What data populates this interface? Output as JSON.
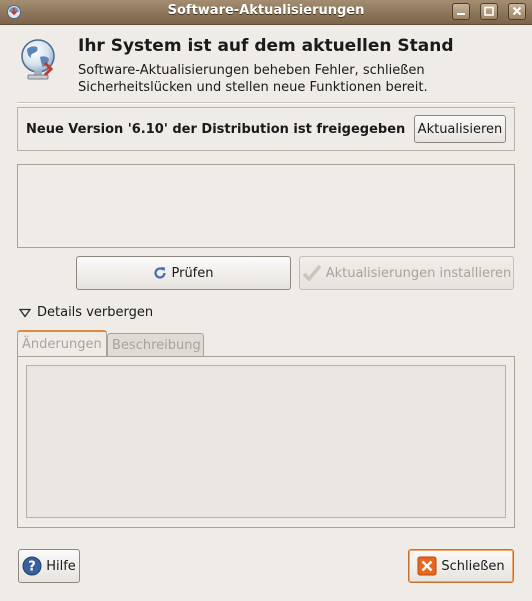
{
  "window": {
    "title": "Software-Aktualisierungen"
  },
  "header": {
    "title": "Ihr System ist auf dem aktuellen Stand",
    "description_line1": "Software-Aktualisierungen beheben Fehler, schließen",
    "description_line2": "Sicherheitslücken und stellen neue Funktionen bereit."
  },
  "release": {
    "message": "Neue Version '6.10' der Distribution ist freigegeben",
    "upgrade_button": "Aktualisieren"
  },
  "actions": {
    "check_button": "Prüfen",
    "install_button": "Aktualisierungen installieren"
  },
  "details": {
    "toggle_label": "Details verbergen",
    "tabs": [
      {
        "label": "Änderungen",
        "active": true
      },
      {
        "label": "Beschreibung",
        "active": false
      }
    ]
  },
  "footer": {
    "help_button": "Hilfe",
    "close_button": "Schließen"
  },
  "icons": {
    "title_icon": "update-manager-icon",
    "header_icon": "globe-update-icon",
    "check_icon": "refresh-icon",
    "install_icon": "checkmark-icon",
    "help_icon": "help-icon",
    "close_icon": "close-icon"
  },
  "colors": {
    "titlebar": "#8c7558",
    "focus_accent": "#e0883e",
    "close_icon_bg": "#e8661e",
    "help_icon_bg": "#3a5f9d"
  }
}
